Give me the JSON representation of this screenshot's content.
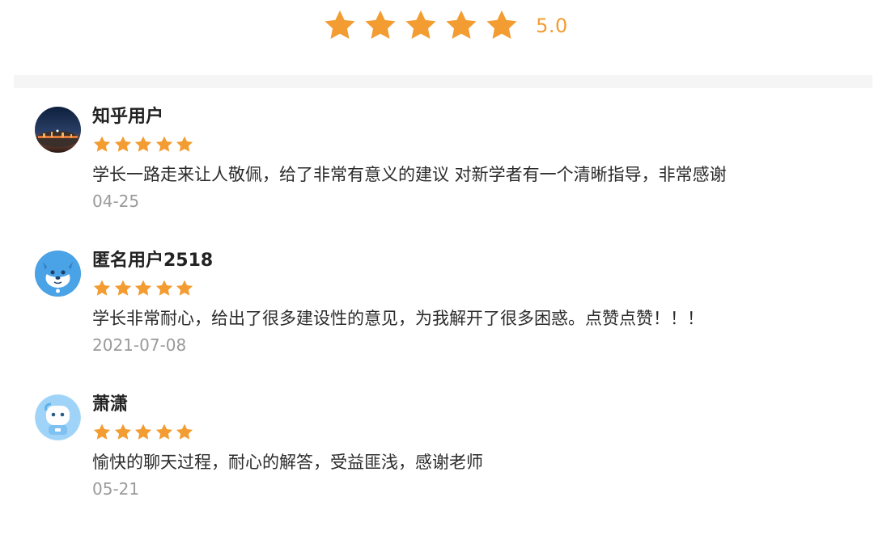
{
  "summary": {
    "rating": 5,
    "max_rating": 5,
    "score_text": "5.0",
    "star_icon": "star-icon",
    "star_color": "#f39c32"
  },
  "reviews": [
    {
      "username": "知乎用户",
      "avatar": "night-city-avatar",
      "rating": 5,
      "comment": "学长一路走来让人敬佩，给了非常有意义的建议 对新学者有一个清晰指导，非常感谢",
      "date": "04-25"
    },
    {
      "username": "匿名用户2518",
      "avatar": "blue-husky-avatar",
      "rating": 5,
      "comment": "学长非常耐心，给出了很多建设性的意见，为我解开了很多困惑。点赞点赞！！！",
      "date": "2021-07-08"
    },
    {
      "username": "萧潇",
      "avatar": "blue-robot-avatar",
      "rating": 5,
      "comment": "愉快的聊天过程，耐心的解答，受益匪浅，感谢老师",
      "date": "05-21"
    }
  ],
  "colors": {
    "star": "#f39c32",
    "divider": "#f5f5f6",
    "date_text": "#9a9a9a"
  }
}
